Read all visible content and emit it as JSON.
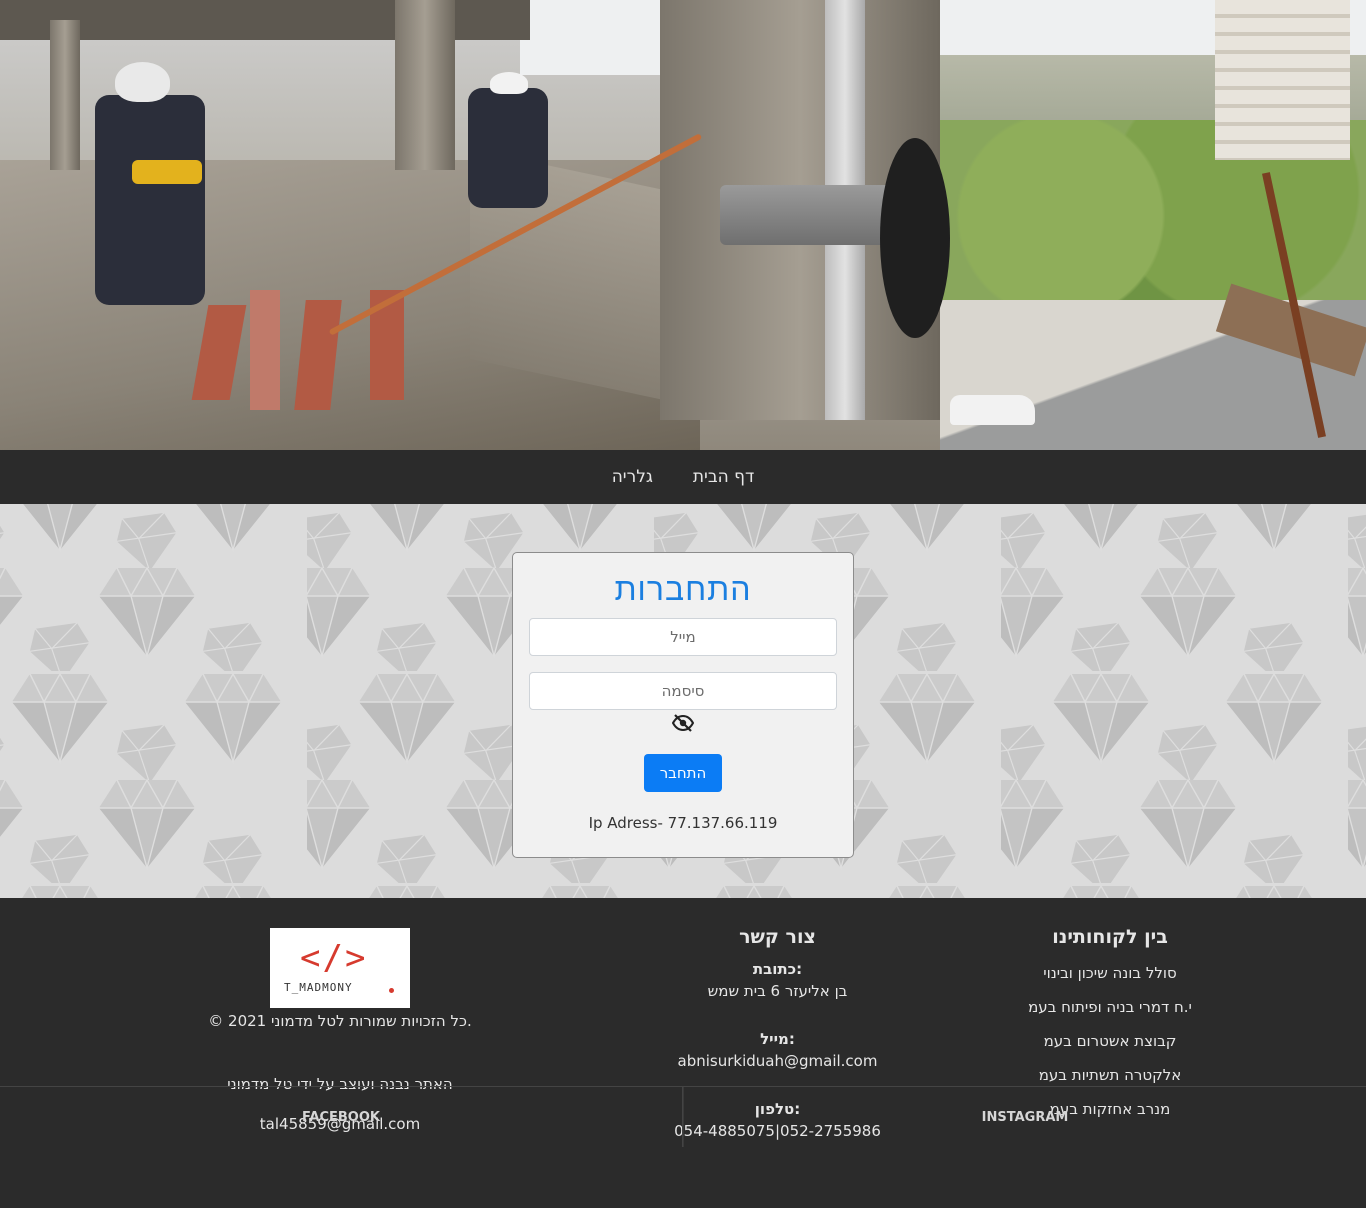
{
  "nav": {
    "home": "דף הבית",
    "gallery": "גלריה"
  },
  "login": {
    "title": "התחברות",
    "email_placeholder": "מייל",
    "password_placeholder": "סיסמה",
    "submit": "התחבר",
    "ip_text": "Ip Adress- 77.137.66.119"
  },
  "footer": {
    "clients": {
      "title": "בין לקוחותינו",
      "items": [
        "סולל בונה שיכון ובינוי",
        "י.ח דמרי בניה ופיתוח בעמ",
        "קבוצת אשטרום בעמ",
        "אלקטרה תשתיות בעמ",
        "מנרב אחזקות בעמ"
      ]
    },
    "contact": {
      "title": "צור קשר",
      "address_label": ":כתובת",
      "address": "בן אליעזר 6 בית שמש",
      "email_label": ":מייל",
      "email": "abnisurkiduah@gmail.com",
      "phone_label": ":טלפון",
      "phone": "052-2755986|054-4885075"
    },
    "credit": {
      "logo_code": "</>",
      "logo_name": "T_MADMONY",
      "copyright": ".כל הזכויות שמורות לטל מדמוני  2021  ©",
      "built_by": "האתר נבנה ועוצב על ידי טל מדמוני",
      "email": "tal45859@gmail.com"
    }
  },
  "social": {
    "facebook": "FACEBOOK",
    "instagram": "INSTAGRAM"
  },
  "colors": {
    "accent": "#0b7cf5",
    "title": "#1b7fe0",
    "dark": "#2b2b2b"
  }
}
